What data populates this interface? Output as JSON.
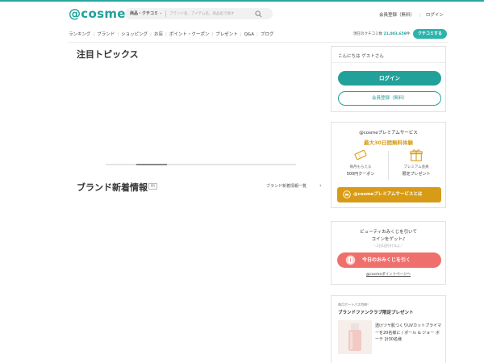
{
  "header": {
    "logo": "@cosme",
    "search": {
      "category": "商品・クチコミ",
      "placeholder": "ブランド名、アイテム名、商品名で探す"
    },
    "links": [
      "会員登録（無料）",
      "ログイン"
    ]
  },
  "nav": {
    "items": [
      "ランキング",
      "ブランド",
      "ショッピング",
      "お店",
      "ポイント・クーポン",
      "プレゼント",
      "Q&A",
      "ブログ"
    ],
    "review_count_label": "現在のクチコミ数",
    "review_count": "21,003,659",
    "review_count_unit": "件",
    "post_button": "クチコミする"
  },
  "main": {
    "topics_title": "注目トピックス",
    "brand_title": "ブランド新着情報",
    "brand_badge": "PR",
    "brand_more": "ブランド新着情報一覧"
  },
  "sidebar": {
    "login_card": {
      "greeting": "こんにちは ゲストさん",
      "login_button": "ログイン",
      "register_button": "会員登録（無料）"
    },
    "premium_card": {
      "title": "@cosmeプレミアムサービス",
      "subtitle": "最大30日間無料体験",
      "left_line1": "毎月もらえる",
      "left_line2": "500円クーポン",
      "right_line1": "プレミアム会員",
      "right_line2": "限定プレゼント",
      "button": "@cosmeプレミアムサービスとは"
    },
    "omikuji_card": {
      "title1": "ビューティおみくじを引いて",
      "title2": "コインをゲット♪",
      "note": "＼1日1回引けるよ／",
      "button": "今日のおみくじを引く",
      "link": "@cosmeポイントページへ"
    },
    "fanclub_card": {
      "small": "毎月ポートパス特典！",
      "title": "ブランドファンクラブ限定プレゼント",
      "desc": "透けツヤ肌つくりUVカットプライマーを20名様に / ポール & ジョー ボーテ 計30名様"
    }
  },
  "colors": {
    "brand_teal": "#22a19b",
    "premium_gold": "#d89b16",
    "omikuji_coral": "#ef6f6c"
  }
}
